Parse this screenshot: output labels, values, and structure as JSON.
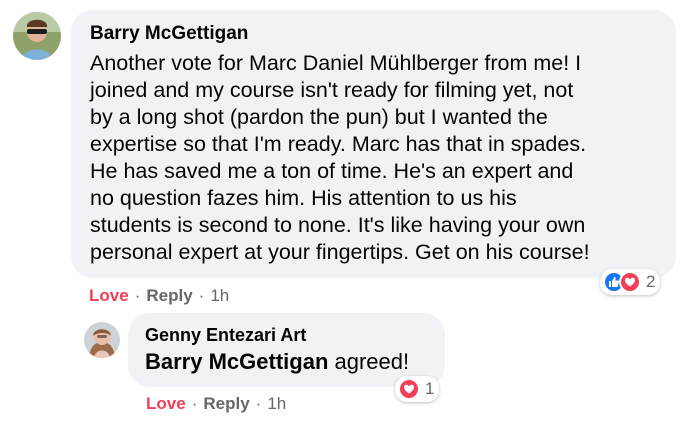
{
  "comment": {
    "author": "Barry McGettigan",
    "lines": [
      "Another vote for Marc Daniel Mühlberger from me! I",
      "joined and my course isn't ready for filming yet, not",
      "by a long shot (pardon the pun) but I wanted the",
      "expertise so that I'm ready. Marc has that in spades.",
      "He has saved me a ton of time. He's an expert and",
      "no question fazes him. His attention to us his",
      "students is second to none. It's like having your own",
      "personal expert at your fingertips. Get on his course!"
    ],
    "reactions": {
      "icons": [
        "like-icon",
        "love-icon"
      ],
      "count": "2"
    },
    "actions": {
      "love_label": "Love",
      "separator": "·",
      "reply_label": "Reply",
      "time": "1h"
    }
  },
  "reply": {
    "author": "Genny Entezari Art",
    "mention": "Barry McGettigan",
    "text": " agreed!",
    "reactions": {
      "icons": [
        "love-icon"
      ],
      "count": "1"
    },
    "actions": {
      "love_label": "Love",
      "separator": "·",
      "reply_label": "Reply",
      "time": "1h"
    }
  },
  "colors": {
    "bubble": "#f0f2f5",
    "love": "#f33e58",
    "like": "#1877f2",
    "meta": "#65676b",
    "text": "#050505"
  }
}
